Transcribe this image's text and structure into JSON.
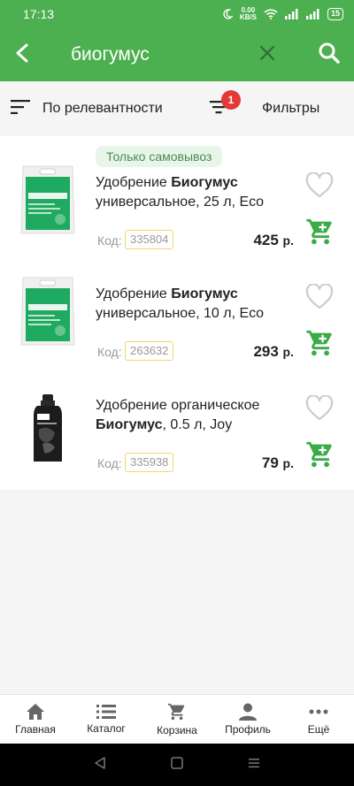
{
  "status_bar": {
    "time": "17:13",
    "speed_value": "0.00",
    "speed_unit": "KB/S",
    "battery": "15"
  },
  "app_bar": {
    "query": "биогумус"
  },
  "sort_bar": {
    "sort_label": "По релевантности",
    "filter_label": "Фильтры",
    "filter_count": "1"
  },
  "products": [
    {
      "badge": "Только самовывоз",
      "title_pre": "Удобрение ",
      "title_bold": "Биогумус",
      "title_post": "универсальное, 25 л, Eco",
      "code_label": "Код:",
      "code": "335804",
      "price": "425",
      "currency": "р."
    },
    {
      "title_pre": "Удобрение ",
      "title_bold": "Биогумус",
      "title_post": "универсальное, 10 л, Eco",
      "code_label": "Код:",
      "code": "263632",
      "price": "293",
      "currency": "р."
    },
    {
      "title_pre": "Удобрение органическое",
      "title_bold": "Биогумус",
      "title_post": ", 0.5 л, Joy",
      "code_label": "Код:",
      "code": "335938",
      "price": "79",
      "currency": "р."
    }
  ],
  "bottom_nav": [
    {
      "label": "Главная",
      "icon": "home-icon"
    },
    {
      "label": "Каталог",
      "icon": "catalog-icon"
    },
    {
      "label": "Корзина",
      "icon": "cart-icon"
    },
    {
      "label": "Профиль",
      "icon": "profile-icon"
    },
    {
      "label": "Ещё",
      "icon": "more-icon"
    }
  ],
  "colors": {
    "primary": "#4caf50",
    "badge": "#e53935",
    "pill_bg": "#e8f5e9",
    "code_border": "#f0d66a"
  }
}
